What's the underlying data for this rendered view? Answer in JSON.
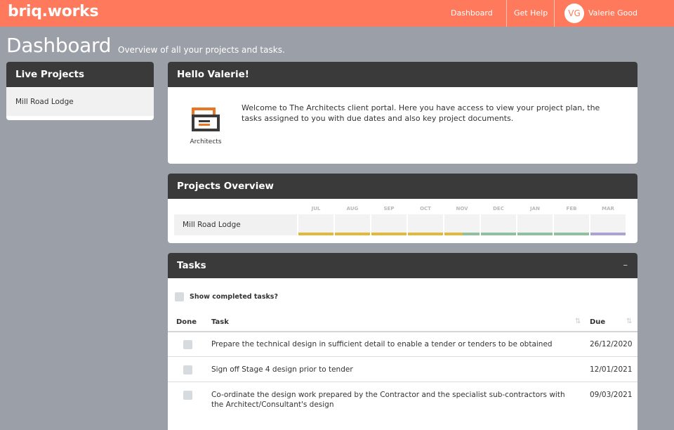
{
  "header": {
    "brand": "briq.works",
    "nav": {
      "dashboard": "Dashboard",
      "help": "Get Help"
    },
    "user": {
      "initials": "VG",
      "name": "Valerie Good"
    }
  },
  "page": {
    "title": "Dashboard",
    "subtitle": "Overview of all your projects and tasks."
  },
  "live_projects": {
    "title": "Live Projects",
    "items": [
      "Mill Road Lodge"
    ]
  },
  "hello": {
    "title": "Hello Valerie!",
    "logo_text": "Architects",
    "welcome": "Welcome to The Architects client portal. Here you have access to view your project plan, the tasks assigned to you with due dates and also key project documents."
  },
  "overview": {
    "title": "Projects Overview",
    "months": [
      "JUL",
      "AUG",
      "SEP",
      "OCT",
      "NOV",
      "DEC",
      "JAN",
      "FEB",
      "MAR"
    ],
    "project": "Mill Road Lodge",
    "stage_colors": {
      "stage_a": "#e2b93b",
      "stage_b": "#8fc19e",
      "stage_c": "#a9a4d4"
    }
  },
  "tasks": {
    "title": "Tasks",
    "collapse_label": "–",
    "show_completed": "Show completed tasks?",
    "columns": {
      "done": "Done",
      "task": "Task",
      "due": "Due"
    },
    "rows": [
      {
        "task": "Prepare the technical design in sufficient detail to enable a tender or tenders to be obtained",
        "due": "26/12/2020"
      },
      {
        "task": "Sign off Stage 4 design prior to tender",
        "due": "12/01/2021"
      },
      {
        "task": "Co-ordinate the design work prepared by the Contractor and the specialist sub-contractors with the Architect/Consultant's design",
        "due": "09/03/2021"
      }
    ]
  }
}
